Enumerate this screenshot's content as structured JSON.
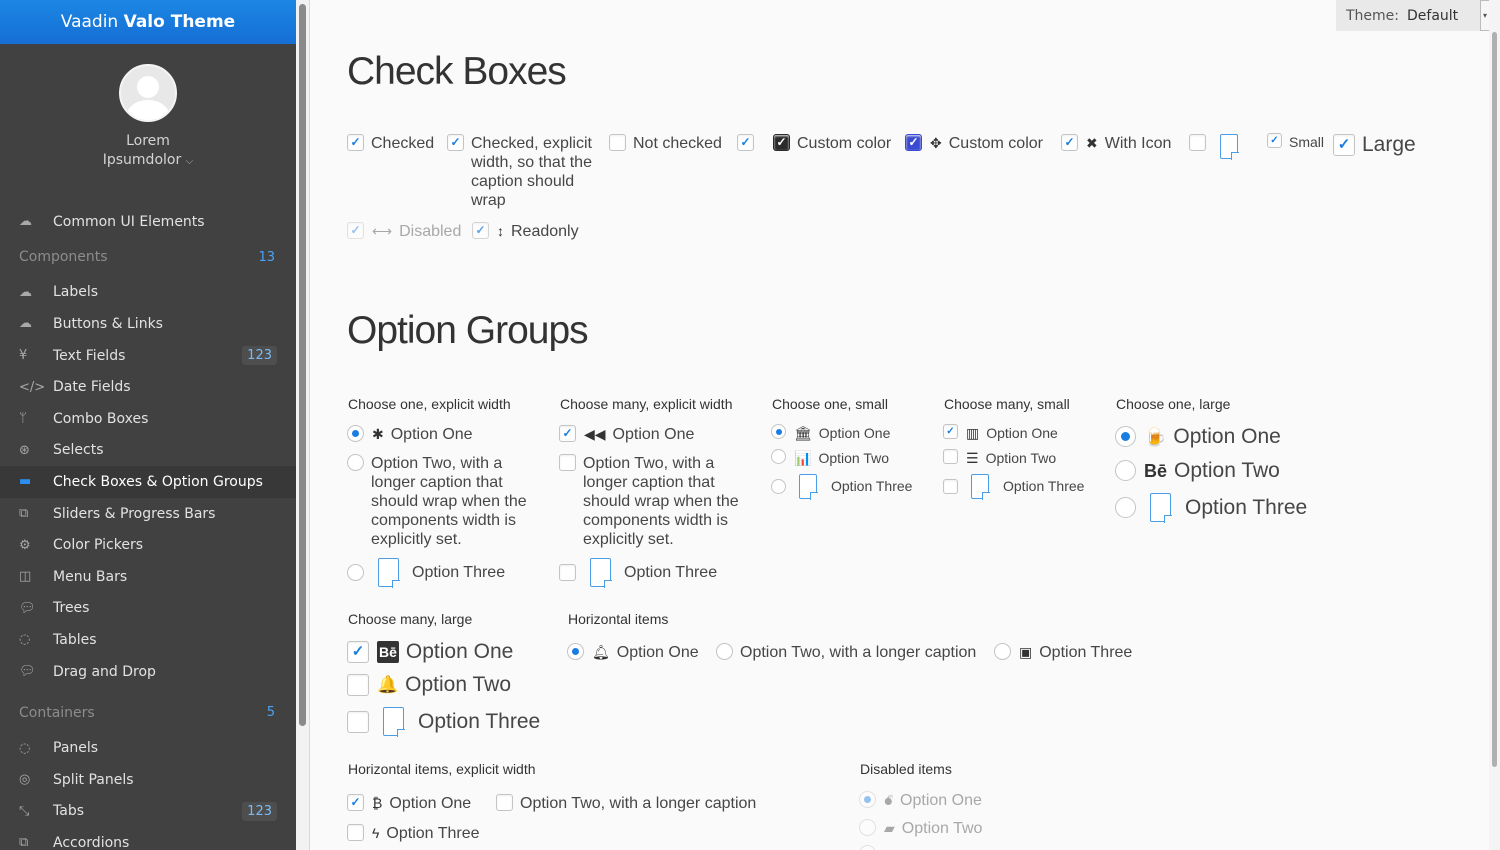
{
  "app": {
    "brand_light": "Vaadin",
    "brand_bold": "Valo Theme"
  },
  "user": {
    "first": "Lorem",
    "last": "Ipsumdolor"
  },
  "sidebar": {
    "top_item": {
      "label": "Common UI Elements",
      "icon": "cloud-icon"
    },
    "components_header": {
      "label": "Components",
      "count": "13"
    },
    "components": [
      {
        "label": "Labels",
        "icon": "cloud-upload-icon"
      },
      {
        "label": "Buttons & Links",
        "icon": "cloud-upload-icon"
      },
      {
        "label": "Text Fields",
        "icon": "yen-icon",
        "badge": "123"
      },
      {
        "label": "Date Fields",
        "icon": "code-icon"
      },
      {
        "label": "Combo Boxes",
        "icon": "git-branch-icon"
      },
      {
        "label": "Selects",
        "icon": "life-ring-icon"
      },
      {
        "label": "Check Boxes & Option Groups",
        "icon": "check-boxes-icon",
        "selected": true
      },
      {
        "label": "Sliders & Progress Bars",
        "icon": "sliders-icon"
      },
      {
        "label": "Color Pickers",
        "icon": "cogs-icon"
      },
      {
        "label": "Menu Bars",
        "icon": "columns-icon"
      },
      {
        "label": "Trees",
        "icon": "comment-icon"
      },
      {
        "label": "Tables",
        "icon": "comment-outline-icon"
      },
      {
        "label": "Drag and Drop",
        "icon": "comments-icon"
      }
    ],
    "containers_header": {
      "label": "Containers",
      "count": "5"
    },
    "containers": [
      {
        "label": "Panels",
        "icon": "comments-outline-icon"
      },
      {
        "label": "Split Panels",
        "icon": "compass-icon"
      },
      {
        "label": "Tabs",
        "icon": "compress-icon",
        "badge": "123"
      },
      {
        "label": "Accordions",
        "icon": "copy-icon"
      }
    ]
  },
  "theme": {
    "label": "Theme:",
    "value": "Default"
  },
  "checkboxes": {
    "title": "Check Boxes",
    "items": {
      "checked": "Checked",
      "explicit": "Checked, explicit width, so that the caption should wrap",
      "not_checked": "Not checked",
      "custom1": "Custom color",
      "custom2": "Custom color",
      "with_icon": "With Icon",
      "small": "Small",
      "large": "Large",
      "disabled": "Disabled",
      "readonly": "Readonly"
    }
  },
  "options": {
    "title": "Option Groups",
    "g1": {
      "title": "Choose one, explicit width",
      "o1": "Option One",
      "o2": "Option Two, with a longer caption that should wrap when the components width is explicitly set.",
      "o3": "Option Three"
    },
    "g2": {
      "title": "Choose many, explicit width",
      "o1": "Option One",
      "o2": "Option Two, with a longer caption that should wrap when the components width is explicitly set.",
      "o3": "Option Three"
    },
    "g3": {
      "title": "Choose one, small",
      "o1": "Option One",
      "o2": "Option Two",
      "o3": "Option Three"
    },
    "g4": {
      "title": "Choose many, small",
      "o1": "Option One",
      "o2": "Option Two",
      "o3": "Option Three"
    },
    "g5": {
      "title": "Choose one, large",
      "o1": "Option One",
      "o2": "Option Two",
      "o3": "Option Three"
    },
    "g6": {
      "title": "Choose many, large",
      "o1": "Option One",
      "o2": "Option Two",
      "o3": "Option Three"
    },
    "g7": {
      "title": "Horizontal items",
      "o1": "Option One",
      "o2": "Option Two, with a longer caption",
      "o3": "Option Three"
    },
    "g8": {
      "title": "Horizontal items, explicit width",
      "o1": "Option One",
      "o2": "Option Two, with a longer caption",
      "o3": "Option Three"
    },
    "g9": {
      "title": "Disabled items",
      "o1": "Option One",
      "o2": "Option Two"
    }
  },
  "colors": {
    "accent": "#197de1",
    "sidebar_bg": "#414141",
    "brand_bar": "#1b87e3"
  }
}
